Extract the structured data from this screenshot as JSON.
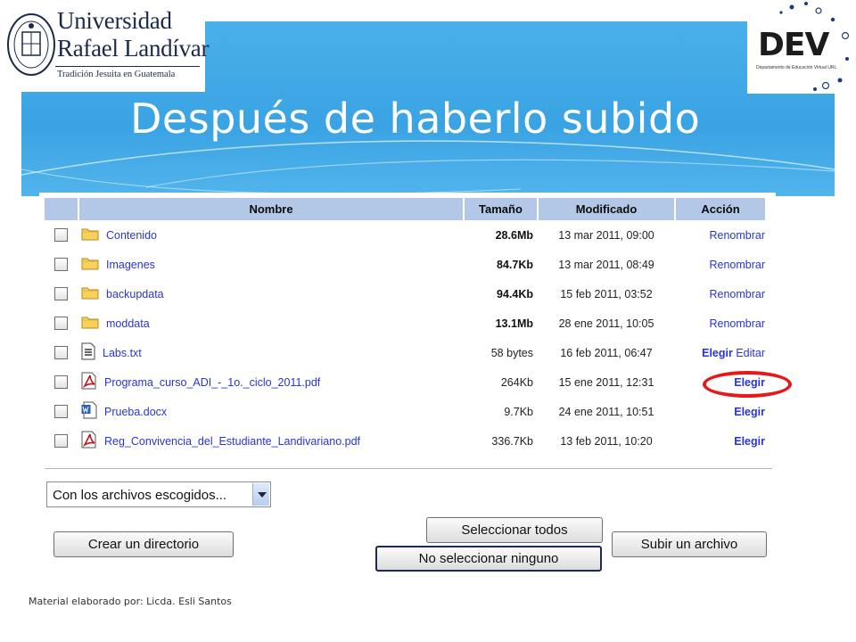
{
  "slide": {
    "title": "Después de haberlo subido",
    "footer": "Material elaborado por: Licda. Esli Santos"
  },
  "logos": {
    "university_line1": "Universidad",
    "university_line2": "Rafael Landívar",
    "university_tagline": "Tradición Jesuita en Guatemala",
    "dev_word": "DEV",
    "dev_subtitle": "Departamento de Educación Virtual URL"
  },
  "table": {
    "headers": {
      "name": "Nombre",
      "size": "Tamaño",
      "modified": "Modificado",
      "action": "Acción"
    },
    "rows": [
      {
        "icon": "folder-icon",
        "name": "Contenido",
        "size": "28.6Mb",
        "modified": "13 mar 2011, 09:00",
        "action": "Renombrar",
        "bold_size": true
      },
      {
        "icon": "folder-icon",
        "name": "Imagenes",
        "size": "84.7Kb",
        "modified": "13 mar 2011, 08:49",
        "action": "Renombrar",
        "bold_size": true
      },
      {
        "icon": "folder-icon",
        "name": "backupdata",
        "size": "94.4Kb",
        "modified": "15 feb 2011, 03:52",
        "action": "Renombrar",
        "bold_size": true
      },
      {
        "icon": "folder-icon",
        "name": "moddata",
        "size": "13.1Mb",
        "modified": "28 ene 2011, 10:05",
        "action": "Renombrar",
        "bold_size": true
      },
      {
        "icon": "text-file-icon",
        "name": "Labs.txt",
        "size": "58 bytes",
        "modified": "16 feb 2011, 06:47",
        "action": "Elegir",
        "action2": "Editar",
        "bold_size": false
      },
      {
        "icon": "pdf-file-icon",
        "name": "Programa_curso_ADI_-_1o._ciclo_2011.pdf",
        "size": "264Kb",
        "modified": "15 ene 2011, 12:31",
        "action": "Elegir",
        "bold_size": false
      },
      {
        "icon": "word-file-icon",
        "name": "Prueba.docx",
        "size": "9.7Kb",
        "modified": "24 ene 2011, 10:51",
        "action": "Elegir",
        "bold_size": false
      },
      {
        "icon": "pdf-file-icon",
        "name": "Reg_Convivencia_del_Estudiante_Landivariano.pdf",
        "size": "336.7Kb",
        "modified": "13 feb 2011, 10:20",
        "action": "Elegir",
        "bold_size": false
      }
    ]
  },
  "controls": {
    "bulk_select": "Con los archivos escogidos...",
    "create_dir": "Crear un directorio",
    "select_all": "Seleccionar todos",
    "select_none": "No seleccionar ninguno",
    "upload": "Subir un archivo"
  },
  "colors": {
    "band": "#3aa3e3",
    "header_cell": "#b3c8e6",
    "link": "#2a34d6",
    "highlight_ring": "#e51919"
  }
}
